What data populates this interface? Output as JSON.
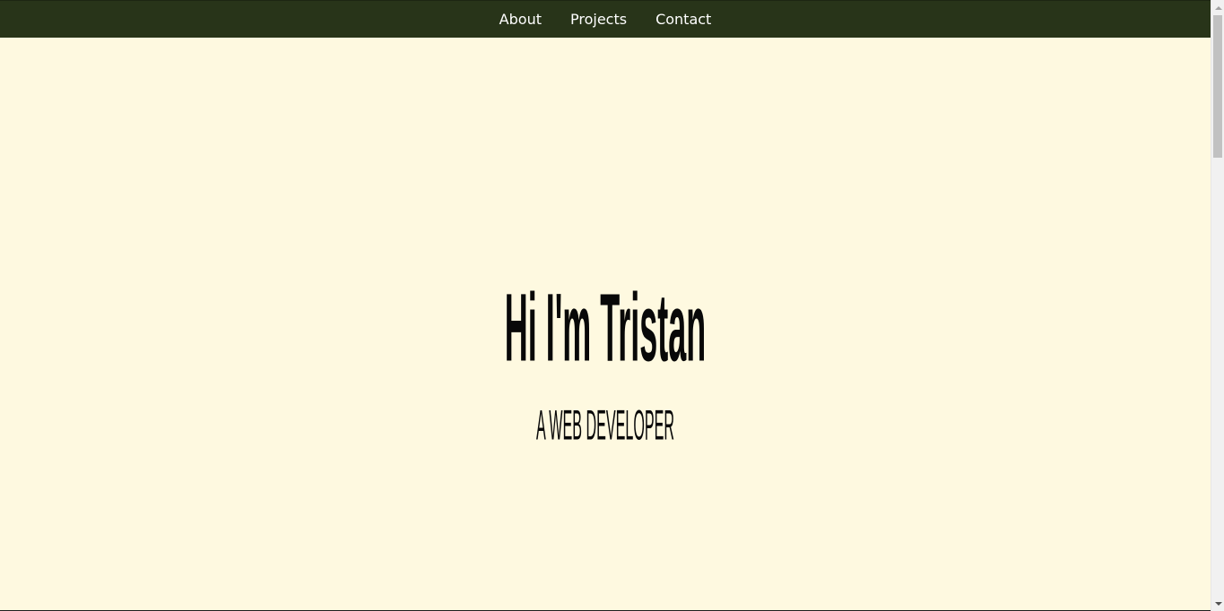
{
  "navigation": {
    "items": [
      {
        "label": "About"
      },
      {
        "label": "Projects"
      },
      {
        "label": "Contact"
      }
    ]
  },
  "hero": {
    "title": "Hi I'm Tristan",
    "subtitle": "A WEB DEVELOPER"
  },
  "scrollbar": {
    "position_fraction": 0.0
  },
  "colors": {
    "nav_background": "#283419",
    "page_background": "#fef9e0",
    "text": "#080808"
  }
}
